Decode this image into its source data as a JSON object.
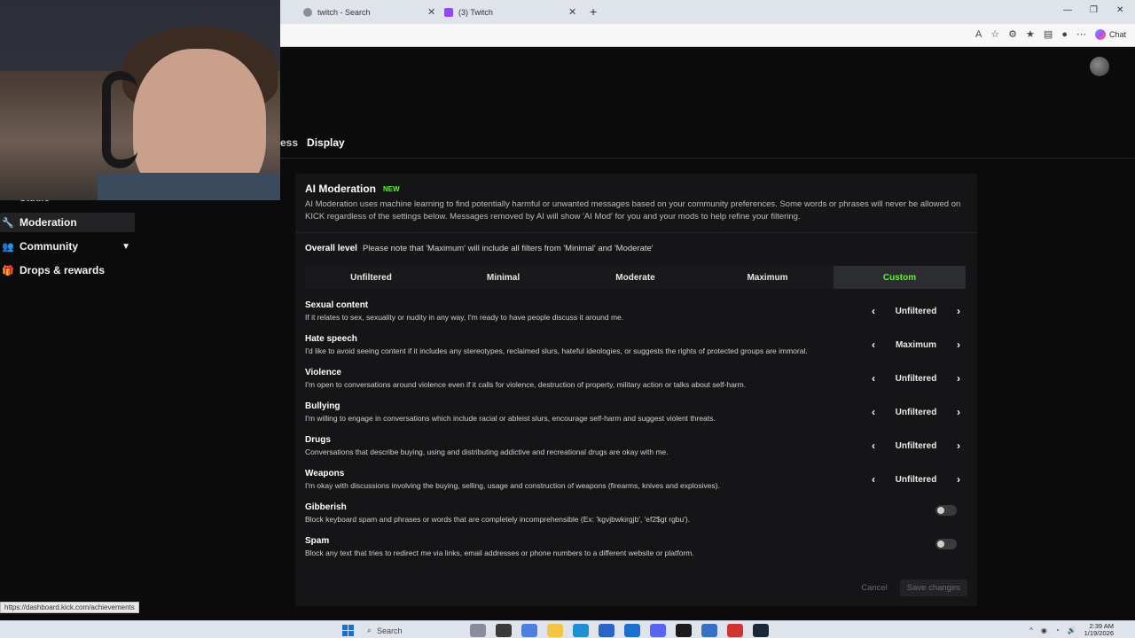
{
  "browser": {
    "tabs": [
      {
        "title": "twitch - Search",
        "favicon_color": "#8a8f99"
      },
      {
        "title": "(3) Twitch",
        "favicon_color": "#9146ff"
      }
    ],
    "chat_label": "Chat"
  },
  "tabs_row": {
    "partial": "ess",
    "display": "Display"
  },
  "sidebar": {
    "studio": "Studio",
    "items": [
      {
        "label": "Moderation",
        "icon": "wrench-icon"
      },
      {
        "label": "Community",
        "icon": "people-icon"
      },
      {
        "label": "Drops & rewards",
        "icon": "gift-icon"
      }
    ]
  },
  "ai_moderation": {
    "title": "AI Moderation",
    "badge": "NEW",
    "description": "AI Moderation uses machine learning to find potentially harmful or unwanted messages based on your community preferences. Some words or phrases will never be allowed on KICK regardless of the settings below. Messages removed by AI will show 'AI Mod' for you and your mods to help refine your filtering.",
    "overall_label": "Overall level",
    "overall_note": "Please note that 'Maximum' will include all filters from 'Minimal' and 'Moderate'",
    "levels": [
      "Unfiltered",
      "Minimal",
      "Moderate",
      "Maximum",
      "Custom"
    ],
    "selected_level": "Custom",
    "categories": [
      {
        "name": "Sexual content",
        "desc": "If it relates to sex, sexuality or nudity in any way, I'm ready to have people discuss it around me.",
        "value": "Unfiltered"
      },
      {
        "name": "Hate speech",
        "desc": "I'd like to avoid seeing content if it includes any stereotypes, reclaimed slurs, hateful ideologies, or suggests the rights of protected groups are immoral.",
        "value": "Maximum"
      },
      {
        "name": "Violence",
        "desc": "I'm open to conversations around violence even if it calls for violence, destruction of property, military action or talks about self-harm.",
        "value": "Unfiltered"
      },
      {
        "name": "Bullying",
        "desc": "I'm willing to engage in conversations which include racial or ableist slurs, encourage self-harm and suggest violent threats.",
        "value": "Unfiltered"
      },
      {
        "name": "Drugs",
        "desc": "Conversations that describe buying, using and distributing addictive and recreational drugs are okay with me.",
        "value": "Unfiltered"
      },
      {
        "name": "Weapons",
        "desc": "I'm okay with discussions involving the buying, selling, usage and construction of weapons (firearms, knives and explosives).",
        "value": "Unfiltered"
      }
    ],
    "toggles": [
      {
        "name": "Gibberish",
        "desc": "Block keyboard spam and phrases or words that are completely incomprehensible (Ex: 'kgvjbwkirgjb', 'ef2$gt rgbu').",
        "enabled": false
      },
      {
        "name": "Spam",
        "desc": "Block any text that tries to redirect me via links, email addresses or phone numbers to a different website or platform.",
        "enabled": false
      }
    ],
    "cancel": "Cancel",
    "save": "Save changes"
  },
  "status_url": "https://dashboard.kick.com/achievements",
  "taskbar": {
    "search": "Search",
    "time": "2:39 AM",
    "date": "1/19/2026"
  },
  "colors": {
    "accent": "#53fc18",
    "background": "#0b0b0c",
    "card": "#151517"
  }
}
